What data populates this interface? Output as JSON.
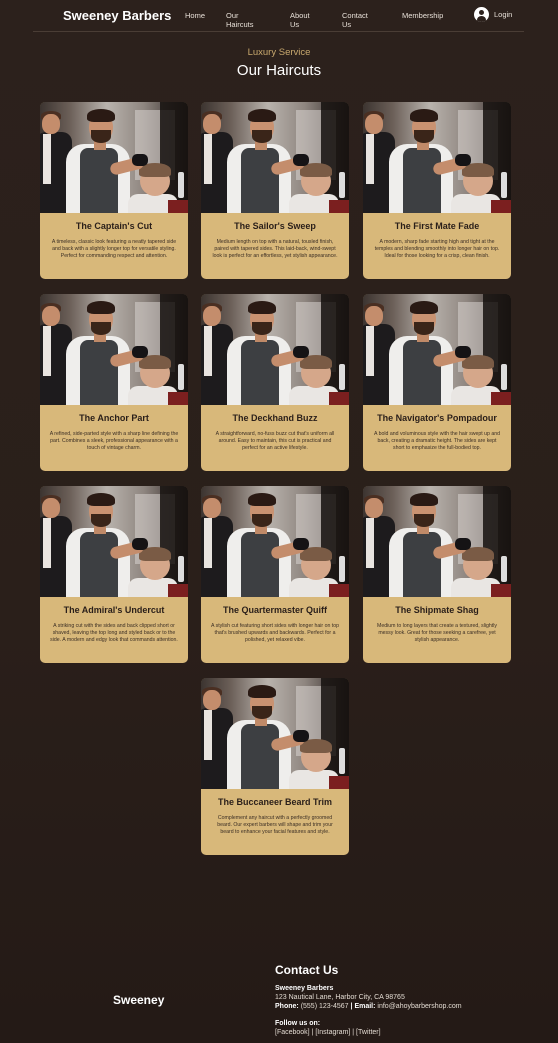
{
  "nav": {
    "brand": "Sweeney Barbers",
    "links": [
      "Home",
      "Our Haircuts",
      "About Us",
      "Contact Us",
      "Membership"
    ],
    "login": "Login"
  },
  "hero": {
    "subtitle": "Luxury Service",
    "title": "Our Haircuts"
  },
  "haircuts": [
    {
      "name": "The Captain's Cut",
      "desc": "A timeless, classic look featuring a neatly tapered side and back with a slightly longer top for versatile styling. Perfect for commanding respect and attention."
    },
    {
      "name": "The Sailor's Sweep",
      "desc": "Medium length on top with a natural, tousled finish, paired with tapered sides. This laid-back, wind-swept look is perfect for an effortless, yet stylish appearance."
    },
    {
      "name": "The First Mate Fade",
      "desc": "A modern, sharp fade starting high and tight at the temples and blending smoothly into longer hair on top. Ideal for those looking for a crisp, clean finish."
    },
    {
      "name": "The Anchor Part",
      "desc": "A refined, side-parted style with a sharp line defining the part. Combines a sleek, professional appearance with a touch of vintage charm."
    },
    {
      "name": "The Deckhand Buzz",
      "desc": "A straightforward, no-fuss buzz cut that's uniform all around. Easy to maintain, this cut is practical and perfect for an active lifestyle."
    },
    {
      "name": "The Navigator's Pompadour",
      "desc": "A bold and voluminous style with the hair swept up and back, creating a dramatic height. The sides are kept short to emphasize the full-bodied top."
    },
    {
      "name": "The Admiral's Undercut",
      "desc": "A striking cut with the sides and back clipped short or shaved, leaving the top long and styled back or to the side. A modern and edgy look that commands attention."
    },
    {
      "name": "The Quartermaster Quiff",
      "desc": "A stylish cut featuring short sides with longer hair on top that's brushed upwards and backwards. Perfect for a polished, yet relaxed vibe."
    },
    {
      "name": "The Shipmate Shag",
      "desc": "Medium to long layers that create a textured, slightly messy look. Great for those seeking a carefree, yet stylish appearance."
    },
    {
      "name": "The Buccaneer Beard Trim",
      "desc": "Complement any haircut with a perfectly groomed beard. Our expert barbers will shape and trim your beard to enhance your facial features and style."
    }
  ],
  "footer": {
    "brand": "Sweeney",
    "contact_title": "Contact Us",
    "company": "Sweeney Barbers",
    "address": "123 Nautical Lane, Harbor City, CA 98765",
    "phone_label": "Phone:",
    "phone": "(555) 123-4567",
    "separator": "|",
    "email_label": "Email:",
    "email": "info@ahoybarbershop.com",
    "follow_label": "Follow us on:",
    "social": "[Facebook] | [Instagram] | [Twitter]"
  }
}
